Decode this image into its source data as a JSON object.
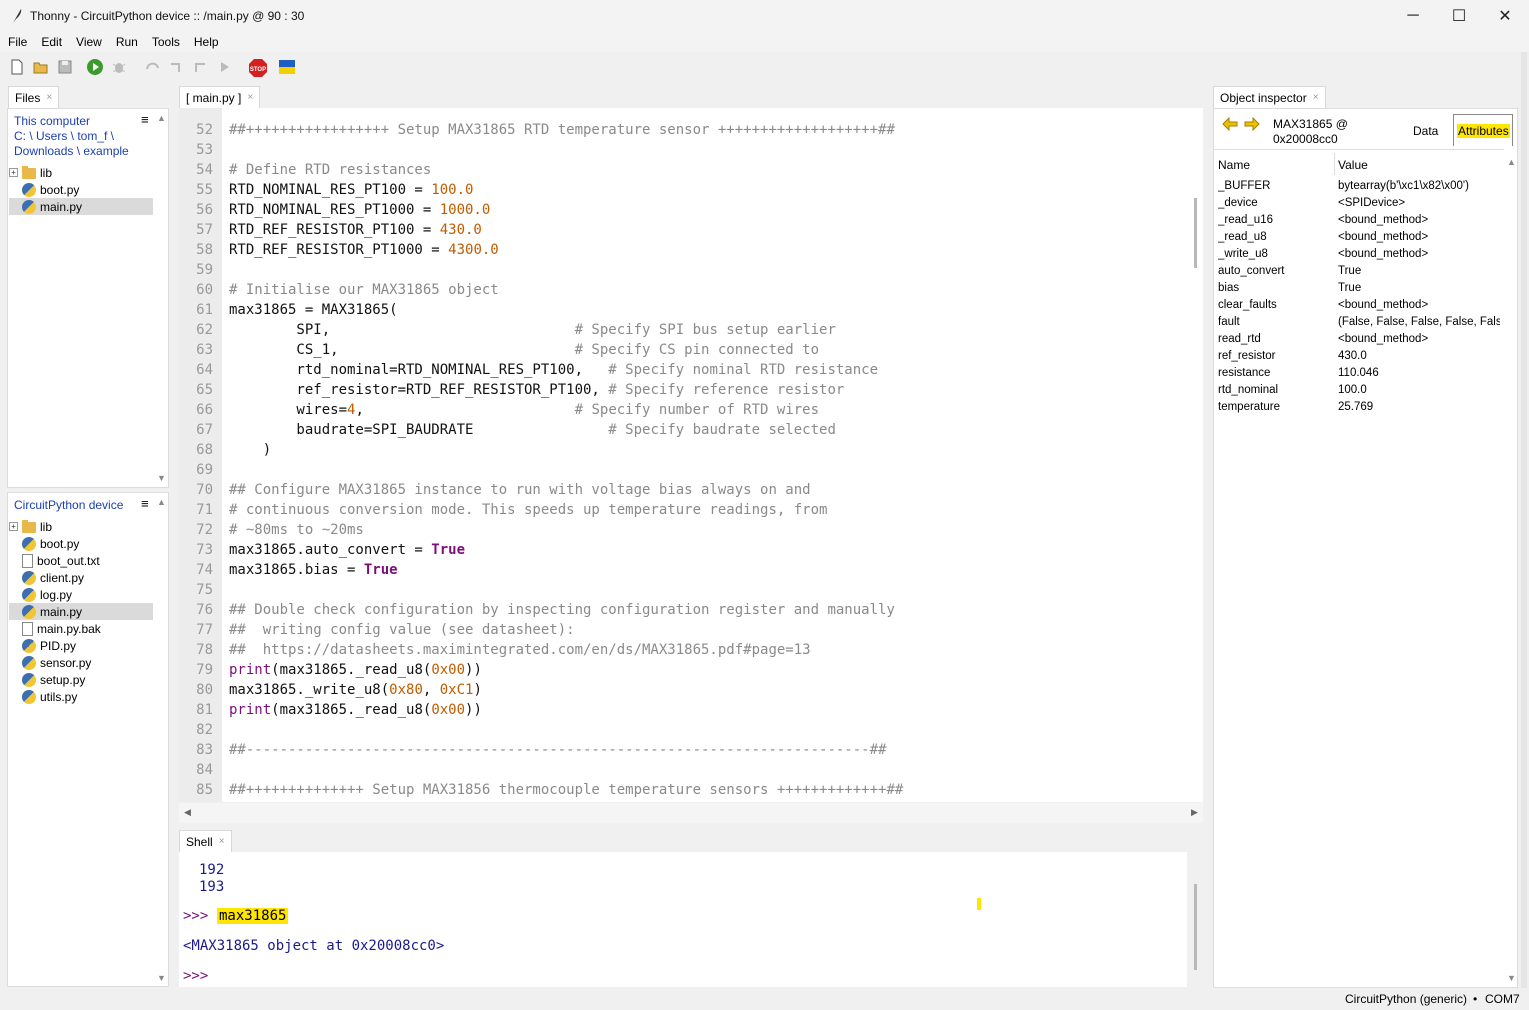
{
  "window": {
    "title": "Thonny  -  CircuitPython device :: /main.py  @  90 : 30",
    "minimize": "─",
    "maximize": "☐",
    "close": "✕"
  },
  "menu": [
    "File",
    "Edit",
    "View",
    "Run",
    "Tools",
    "Help"
  ],
  "toolbar": {
    "icons": [
      "new-file-icon",
      "open-file-icon",
      "save-icon",
      "run-icon",
      "debug-icon",
      "step-over-icon",
      "step-into-icon",
      "step-out-icon",
      "resume-icon",
      "stop-icon",
      "ukraine-flag-icon"
    ],
    "stop_label": "STOP"
  },
  "files_panel": {
    "tab_label": "Files",
    "close_glyph": "×",
    "computer": {
      "header": "This computer",
      "path_line1": "C: \\ Users \\ tom_f \\",
      "path_line2": "Downloads \\ example",
      "items": [
        {
          "name": "lib",
          "type": "folder"
        },
        {
          "name": "boot.py",
          "type": "py"
        },
        {
          "name": "main.py",
          "type": "py",
          "selected": true
        }
      ]
    },
    "device": {
      "header": "CircuitPython device",
      "items": [
        {
          "name": "lib",
          "type": "folder"
        },
        {
          "name": "boot.py",
          "type": "py"
        },
        {
          "name": "boot_out.txt",
          "type": "txt"
        },
        {
          "name": "client.py",
          "type": "py"
        },
        {
          "name": "log.py",
          "type": "py"
        },
        {
          "name": "main.py",
          "type": "py",
          "selected": true
        },
        {
          "name": "main.py.bak",
          "type": "txt"
        },
        {
          "name": "PID.py",
          "type": "py"
        },
        {
          "name": "sensor.py",
          "type": "py"
        },
        {
          "name": "setup.py",
          "type": "py"
        },
        {
          "name": "utils.py",
          "type": "py"
        }
      ]
    },
    "menu_glyph": "≡"
  },
  "editor": {
    "tab_label": "[ main.py ]",
    "close_glyph": "×",
    "lines": [
      {
        "n": "52",
        "parts": [
          [
            "c-com",
            "##+++++++++++++++++ Setup MAX31865 RTD temperature sensor +++++++++++++++++++##"
          ]
        ]
      },
      {
        "n": "53",
        "parts": []
      },
      {
        "n": "54",
        "parts": [
          [
            "c-com",
            "# Define RTD resistances"
          ]
        ]
      },
      {
        "n": "55",
        "parts": [
          [
            "",
            "RTD_NOMINAL_RES_PT100 = "
          ],
          [
            "c-num",
            "100.0"
          ]
        ]
      },
      {
        "n": "56",
        "parts": [
          [
            "",
            "RTD_NOMINAL_RES_PT1000 = "
          ],
          [
            "c-num",
            "1000.0"
          ]
        ]
      },
      {
        "n": "57",
        "parts": [
          [
            "",
            "RTD_REF_RESISTOR_PT100 = "
          ],
          [
            "c-num",
            "430.0"
          ]
        ]
      },
      {
        "n": "58",
        "parts": [
          [
            "",
            "RTD_REF_RESISTOR_PT1000 = "
          ],
          [
            "c-num",
            "4300.0"
          ]
        ]
      },
      {
        "n": "59",
        "parts": []
      },
      {
        "n": "60",
        "parts": [
          [
            "c-com",
            "# Initialise our MAX31865 object"
          ]
        ]
      },
      {
        "n": "61",
        "parts": [
          [
            "",
            "max31865 = MAX31865("
          ]
        ]
      },
      {
        "n": "62",
        "parts": [
          [
            "",
            "        SPI,                             "
          ],
          [
            "c-com",
            "# Specify SPI bus setup earlier"
          ]
        ]
      },
      {
        "n": "63",
        "parts": [
          [
            "",
            "        CS_1,                            "
          ],
          [
            "c-com",
            "# Specify CS pin connected to"
          ]
        ]
      },
      {
        "n": "64",
        "parts": [
          [
            "",
            "        rtd_nominal=RTD_NOMINAL_RES_PT100,   "
          ],
          [
            "c-com",
            "# Specify nominal RTD resistance"
          ]
        ]
      },
      {
        "n": "65",
        "parts": [
          [
            "",
            "        ref_resistor=RTD_REF_RESISTOR_PT100, "
          ],
          [
            "c-com",
            "# Specify reference resistor"
          ]
        ]
      },
      {
        "n": "66",
        "parts": [
          [
            "",
            "        wires="
          ],
          [
            "c-num",
            "4"
          ],
          [
            "",
            ",                         "
          ],
          [
            "c-com",
            "# Specify number of RTD wires"
          ]
        ]
      },
      {
        "n": "67",
        "parts": [
          [
            "",
            "        baudrate=SPI_BAUDRATE                "
          ],
          [
            "c-com",
            "# Specify baudrate selected"
          ]
        ]
      },
      {
        "n": "68",
        "parts": [
          [
            "",
            "    )"
          ]
        ]
      },
      {
        "n": "69",
        "parts": []
      },
      {
        "n": "70",
        "parts": [
          [
            "c-com",
            "## Configure MAX31865 instance to run with voltage bias always on and"
          ]
        ]
      },
      {
        "n": "71",
        "parts": [
          [
            "c-com",
            "# continuous conversion mode. This speeds up temperature readings, from"
          ]
        ]
      },
      {
        "n": "72",
        "parts": [
          [
            "c-com",
            "# ~80ms to ~20ms"
          ]
        ]
      },
      {
        "n": "73",
        "parts": [
          [
            "",
            "max31865.auto_convert = "
          ],
          [
            "c-kw",
            "True"
          ]
        ]
      },
      {
        "n": "74",
        "parts": [
          [
            "",
            "max31865.bias = "
          ],
          [
            "c-kw",
            "True"
          ]
        ]
      },
      {
        "n": "75",
        "parts": []
      },
      {
        "n": "76",
        "parts": [
          [
            "c-com",
            "## Double check configuration by inspecting configuration register and manually"
          ]
        ]
      },
      {
        "n": "77",
        "parts": [
          [
            "c-com",
            "##  writing config value (see datasheet):"
          ]
        ]
      },
      {
        "n": "78",
        "parts": [
          [
            "c-com",
            "##  https://datasheets.maximintegrated.com/en/ds/MAX31865.pdf#page=13"
          ]
        ]
      },
      {
        "n": "79",
        "parts": [
          [
            "c-fn",
            "print"
          ],
          [
            "",
            "(max31865._read_u8("
          ],
          [
            "c-num",
            "0x00"
          ],
          [
            "",
            "))"
          ]
        ]
      },
      {
        "n": "80",
        "parts": [
          [
            "",
            "max31865._write_u8("
          ],
          [
            "c-num",
            "0x80"
          ],
          [
            "",
            ", "
          ],
          [
            "c-num",
            "0xC1"
          ],
          [
            "",
            ")"
          ]
        ]
      },
      {
        "n": "81",
        "parts": [
          [
            "c-fn",
            "print"
          ],
          [
            "",
            "(max31865._read_u8("
          ],
          [
            "c-num",
            "0x00"
          ],
          [
            "",
            "))"
          ]
        ]
      },
      {
        "n": "82",
        "parts": []
      },
      {
        "n": "83",
        "parts": [
          [
            "c-com",
            "##--------------------------------------------------------------------------##"
          ]
        ]
      },
      {
        "n": "84",
        "parts": []
      },
      {
        "n": "85",
        "parts": [
          [
            "c-com",
            "##++++++++++++++ Setup MAX31856 thermocouple temperature sensors +++++++++++++##"
          ]
        ]
      }
    ]
  },
  "shell": {
    "tab_label": "Shell",
    "close_glyph": "×",
    "out1": "192",
    "out2": "193",
    "prompt": ">>> ",
    "command": "max31865",
    "result": "<MAX31865 object at 0x20008cc0>",
    "prompt2": ">>>"
  },
  "inspector": {
    "tab_label": "Object inspector",
    "close_glyph": "×",
    "object_line1": "MAX31865 @",
    "object_line2": "0x20008cc0",
    "tab_data": "Data",
    "tab_attributes": "Attributes",
    "col_name": "Name",
    "col_value": "Value",
    "rows": [
      {
        "name": "_BUFFER",
        "value": "bytearray(b'\\xc1\\x82\\x00')"
      },
      {
        "name": "_device",
        "value": "<SPIDevice>"
      },
      {
        "name": "_read_u16",
        "value": "<bound_method>"
      },
      {
        "name": "_read_u8",
        "value": "<bound_method>"
      },
      {
        "name": "_write_u8",
        "value": "<bound_method>"
      },
      {
        "name": "auto_convert",
        "value": "True"
      },
      {
        "name": "bias",
        "value": "True"
      },
      {
        "name": "clear_faults",
        "value": "<bound_method>"
      },
      {
        "name": "fault",
        "value": "(False, False, False, False, False,"
      },
      {
        "name": "read_rtd",
        "value": "<bound_method>"
      },
      {
        "name": "ref_resistor",
        "value": "430.0"
      },
      {
        "name": "resistance",
        "value": "110.046"
      },
      {
        "name": "rtd_nominal",
        "value": "100.0"
      },
      {
        "name": "temperature",
        "value": "25.769"
      }
    ]
  },
  "status": {
    "interpreter": "CircuitPython (generic)",
    "separator": "•",
    "port": "COM7"
  },
  "colors": {
    "highlight": "#ffe600",
    "prompt": "#7a0f7a",
    "output": "#1a1a8c",
    "link": "#1c3fb0"
  }
}
